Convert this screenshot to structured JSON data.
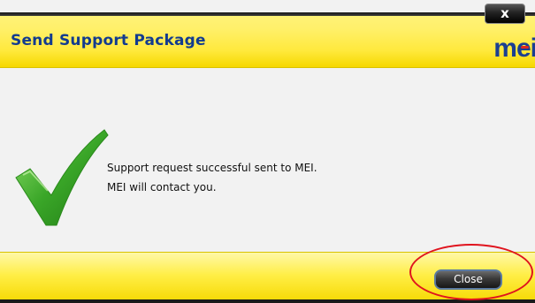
{
  "dialog": {
    "title": "Send Support Package",
    "close_icon_label": "x",
    "logo_text_m": "m",
    "logo_text_e": "e",
    "logo_text_i": "i",
    "message_line1": "Support request successful sent to MEI.",
    "message_line2": "MEI will contact you.",
    "close_button_label": "Close",
    "success_icon": "checkmark-icon"
  },
  "colors": {
    "title_text": "#123b8f",
    "bar_yellow": "#ffe93c",
    "check_green": "#3aa628",
    "highlight_red": "#e0141e"
  }
}
